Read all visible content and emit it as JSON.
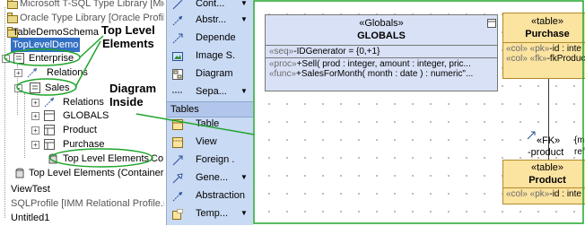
{
  "tree": {
    "items": [
      {
        "label": "Microsoft T-SQL Type Library [Micros"
      },
      {
        "label": "Oracle Type Library [Oracle Profile"
      },
      {
        "label": "TableDemoSchema"
      },
      {
        "label": "TopLevelDemo"
      },
      {
        "label": "Enterprise"
      },
      {
        "label": "Relations"
      },
      {
        "label": "Sales"
      },
      {
        "label": "Relations"
      },
      {
        "label": "GLOBALS"
      },
      {
        "label": "Product"
      },
      {
        "label": "Purchase"
      },
      {
        "label": "Top Level Elements"
      },
      {
        "label": "Top Level Elements (Containers"
      },
      {
        "label": "ViewTest"
      },
      {
        "label": "SQLProfile [IMM Relational Profile.m"
      },
      {
        "label": "Untitled1"
      }
    ],
    "extra": "Co"
  },
  "annotations": {
    "top_level_elements": "Top Level\nElements",
    "diagram_inside": "Diagram\nInside"
  },
  "palette": {
    "items": [
      {
        "label": "Cont...",
        "icon": "constraint-icon",
        "has_arrow": true
      },
      {
        "label": "Abstr...",
        "icon": "abstraction-icon",
        "has_arrow": true
      },
      {
        "label": "Depende...",
        "icon": "dependency-icon",
        "has_arrow": false
      },
      {
        "label": "Image S...",
        "icon": "image-shape-icon",
        "has_arrow": false
      },
      {
        "label": "Diagram ...",
        "icon": "diagram-icon",
        "has_arrow": false
      },
      {
        "label": "Sepa...",
        "icon": "separator-icon",
        "has_arrow": true
      }
    ],
    "section_header": "Tables",
    "section_items": [
      {
        "label": "Table",
        "icon": "table-icon",
        "has_arrow": false
      },
      {
        "label": "View",
        "icon": "view-icon",
        "has_arrow": false
      },
      {
        "label": "Foreign ...",
        "icon": "foreign-key-icon",
        "has_arrow": false
      },
      {
        "label": "Gene...",
        "icon": "generalization-icon",
        "has_arrow": true
      },
      {
        "label": "Abstraction",
        "icon": "abstraction-icon",
        "has_arrow": false
      },
      {
        "label": "Temp...",
        "icon": "template-icon",
        "has_arrow": true
      }
    ]
  },
  "diagram": {
    "globals": {
      "stereotype": "«Globals»",
      "name": "GLOBALS",
      "attr_prefix": "«seq»",
      "attr": "-IDGenerator = {0,+1}",
      "op1_prefix": "«proc»",
      "op1": "+Sell( prod : integer, amount : integer, pric...",
      "op2_prefix": "«func»",
      "op2": "+SalesForMonth( month : date ) : numeric\"..."
    },
    "purchase": {
      "stereotype": "«table»",
      "name": "Purchase",
      "col1_prefix": "«col» «pk»",
      "col1": "-id : inte",
      "col2_prefix": "«col» «fk»",
      "col2": "-fkProduct : int"
    },
    "fk": {
      "stereotype": "«FK»",
      "role": "-product",
      "side1": "{m",
      "side2": "ref"
    },
    "product": {
      "stereotype": "«table»",
      "name": "Product",
      "col1_prefix": "«col» «pk»",
      "col1": "-id : inte"
    }
  },
  "colors": {
    "palette_bg": "#c9daf4",
    "selection": "#3470c4",
    "highlight_green": "#1fa52b",
    "globals_bg": "#d9e1f6",
    "table_bg": "#fbe3a0"
  }
}
